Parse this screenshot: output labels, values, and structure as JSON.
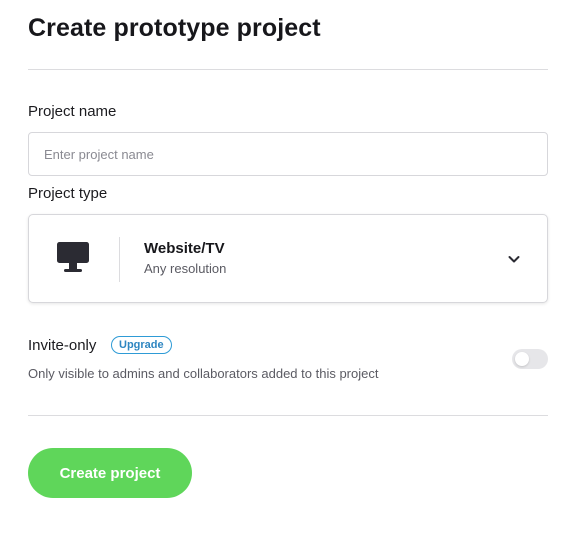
{
  "dialog": {
    "title": "Create prototype project"
  },
  "project_name": {
    "label": "Project name",
    "value": "",
    "placeholder": "Enter project name"
  },
  "project_type": {
    "label": "Project type",
    "selected": {
      "icon": "monitor-icon",
      "title": "Website/TV",
      "subtitle": "Any resolution"
    },
    "dropdown_icon": "chevron-down-icon"
  },
  "invite_only": {
    "label": "Invite-only",
    "badge": "Upgrade",
    "description": "Only visible to admins and collaborators added to this project",
    "enabled": false
  },
  "actions": {
    "create_label": "Create project"
  },
  "colors": {
    "primary_button": "#5fd65a",
    "badge_accent": "#2e9bd6",
    "toggle_off": "#e6e6e9",
    "divider": "#dcdcdf"
  }
}
